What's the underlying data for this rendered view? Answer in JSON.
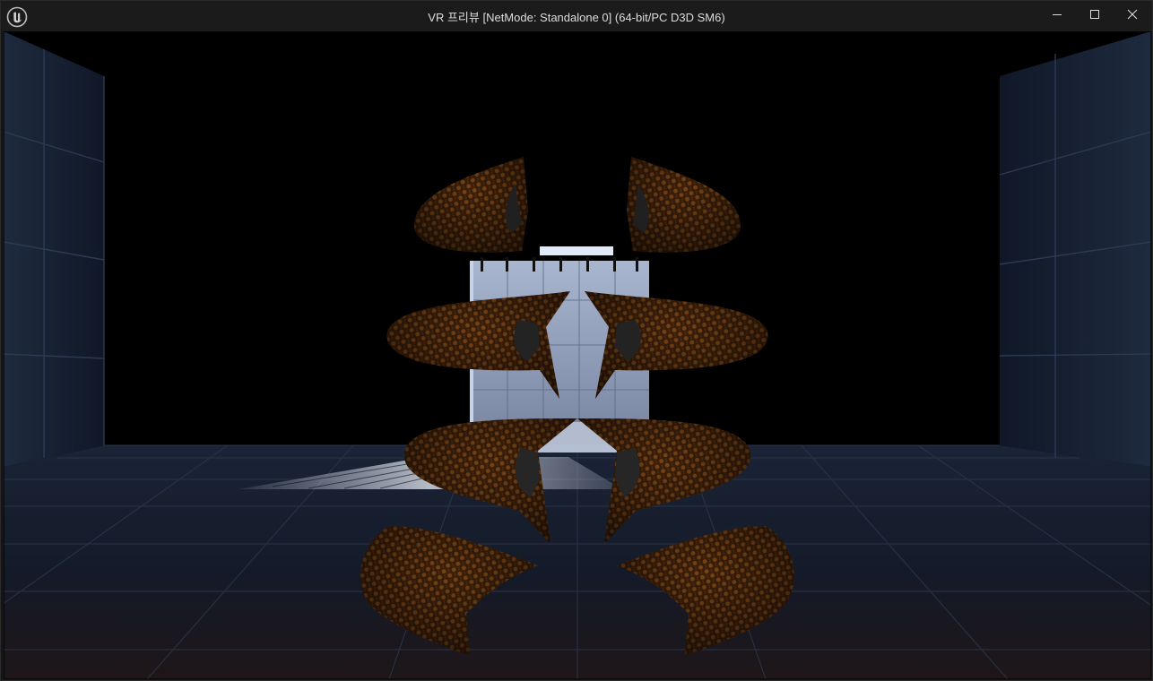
{
  "window": {
    "title": "VR 프리뷰 [NetMode: Standalone 0]  (64-bit/PC D3D SM6)"
  },
  "titlebar_buttons": {
    "minimize_icon": "minimize-icon",
    "maximize_icon": "maximize-icon",
    "close_icon": "close-icon"
  },
  "app_icon": "unreal-engine-logo-icon",
  "colors": {
    "titlebar": "#1b1b1b",
    "title_text": "#dcdcdc",
    "wall_blue": "#1c2638",
    "floor_blue": "#1a2232",
    "tentacle_brown": "#5a3210",
    "tentacle_orange": "#a35d1c"
  }
}
